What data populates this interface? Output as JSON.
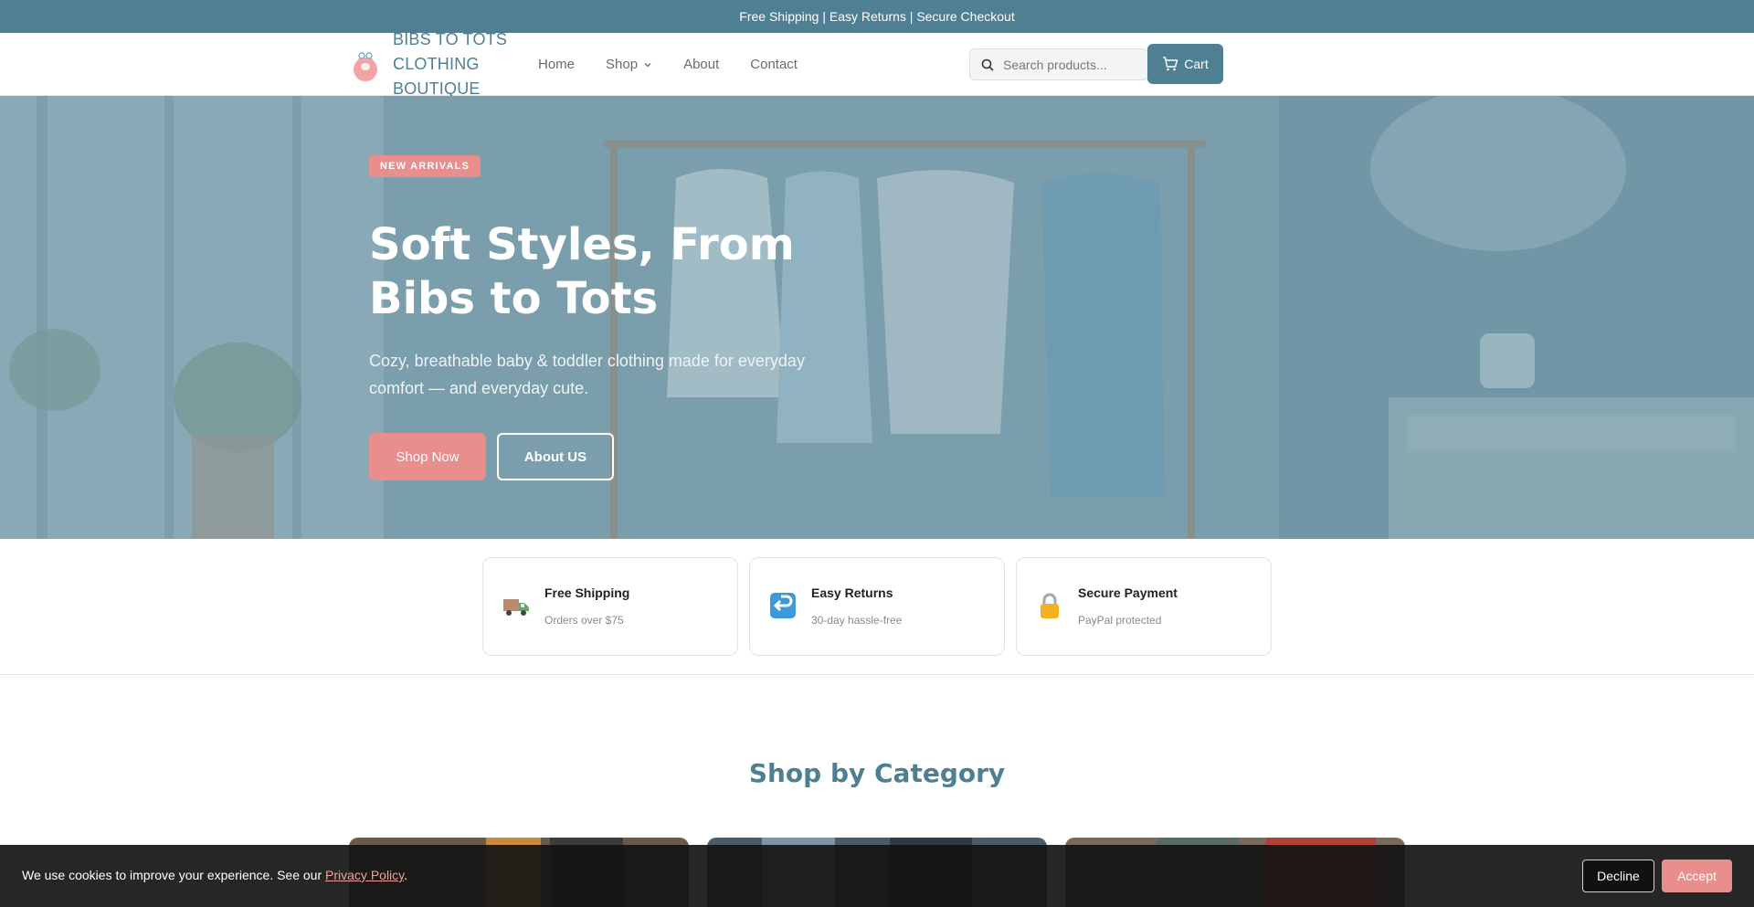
{
  "announcement": "Free Shipping | Easy Returns | Secure Checkout",
  "brand": {
    "name_line1": "BIBS TO TOTS",
    "name_line2": "CLOTHING",
    "name_line3": "BOUTIQUE"
  },
  "nav": {
    "home": "Home",
    "shop": "Shop",
    "about": "About",
    "contact": "Contact"
  },
  "search": {
    "placeholder": "Search products..."
  },
  "cart": {
    "label": "Cart"
  },
  "hero": {
    "badge": "NEW ARRIVALS",
    "title": "Soft Styles, From Bibs to Tots",
    "subtitle": "Cozy, breathable baby & toddler clothing made for everyday comfort — and everyday cute.",
    "shop_button": "Shop Now",
    "about_button": "About US"
  },
  "features": [
    {
      "title": "Free Shipping",
      "subtitle": "Orders over $75",
      "icon": "delivery-truck-icon"
    },
    {
      "title": "Easy Returns",
      "subtitle": "30-day hassle-free",
      "icon": "return-arrow-icon"
    },
    {
      "title": "Secure Payment",
      "subtitle": "PayPal protected",
      "icon": "padlock-icon"
    }
  ],
  "categories": {
    "title": "Shop by Category"
  },
  "cookie": {
    "text": "We use cookies to improve your experience. See our ",
    "link": "Privacy Policy",
    "after": ".",
    "decline": "Decline",
    "accept": "Accept"
  },
  "colors": {
    "primary": "#4e7f93",
    "accent": "#e88e8c",
    "dark": "#141414"
  }
}
